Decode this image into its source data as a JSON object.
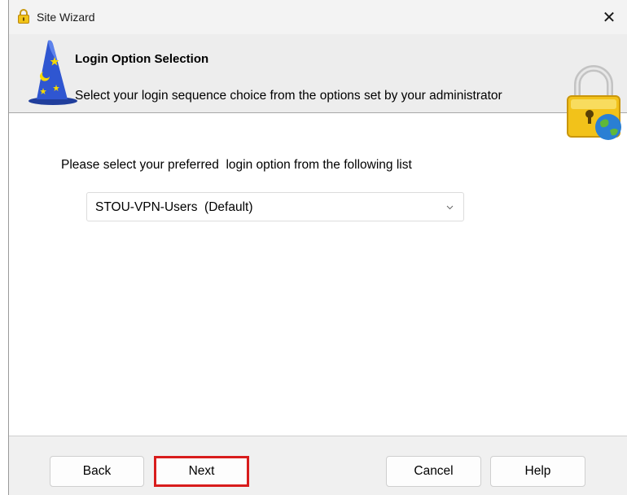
{
  "window": {
    "title": "Site Wizard",
    "close_glyph": "✕"
  },
  "header": {
    "title": "Login Option Selection",
    "subtitle": "Select your login sequence choice from the options set by your administrator",
    "left_icon": "wizard-hat-icon",
    "right_icon": "lock-globe-icon"
  },
  "content": {
    "prompt": "Please select your preferred  login option from the following list",
    "login_option": {
      "selected": "STOU-VPN-Users  (Default)"
    }
  },
  "footer": {
    "back_label": "Back",
    "next_label": "Next",
    "cancel_label": "Cancel",
    "help_label": "Help"
  },
  "colors": {
    "highlight": "#d81c1c",
    "header_bg": "#ededed",
    "footer_bg": "#f0f0f0"
  }
}
